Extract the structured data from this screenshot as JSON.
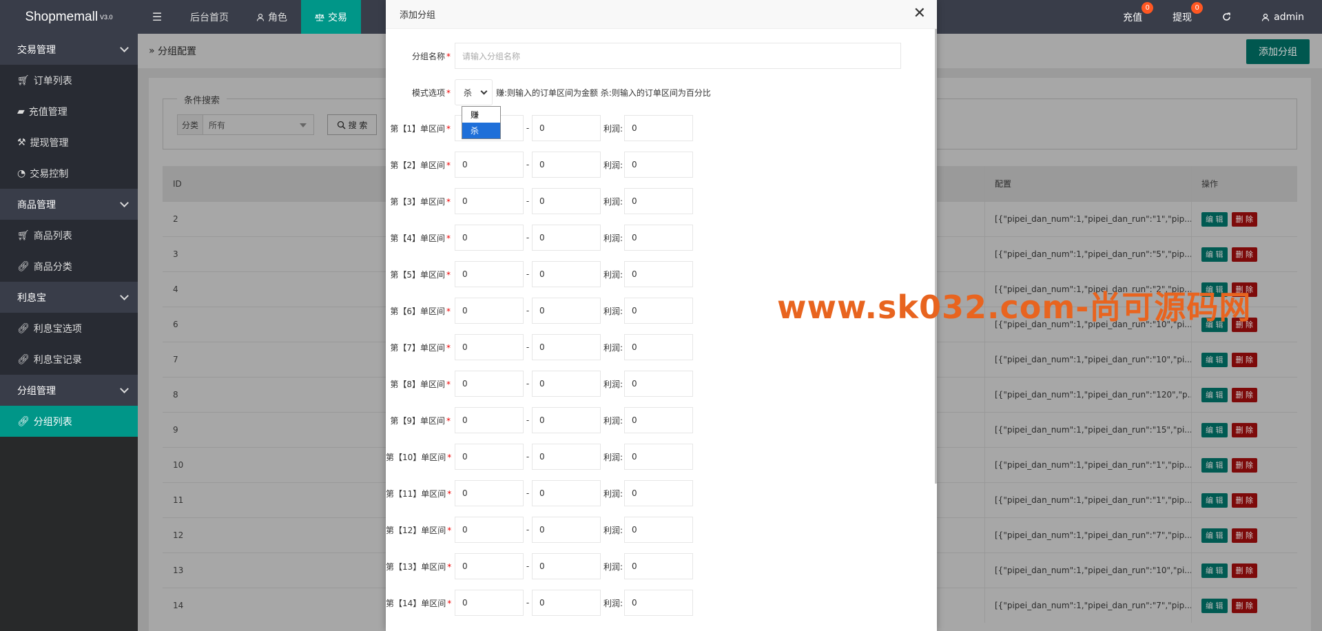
{
  "brand": {
    "name": "Shopmemall",
    "version": "V3.0"
  },
  "topnav": {
    "items": [
      {
        "label": "后台首页",
        "icon": ""
      },
      {
        "label": "角色",
        "icon": "user-icon"
      },
      {
        "label": "交易",
        "icon": "scale-icon",
        "active": true
      }
    ],
    "recharge": {
      "label": "充值",
      "badge": "0"
    },
    "withdraw": {
      "label": "提现",
      "badge": "0"
    },
    "admin": "admin"
  },
  "sidebar": {
    "groups": [
      {
        "label": "交易管理",
        "items": [
          {
            "label": "订单列表",
            "icon": "cart-icon"
          },
          {
            "label": "充值管理",
            "icon": "card-icon"
          },
          {
            "label": "提现管理",
            "icon": "hammer-icon"
          },
          {
            "label": "交易控制",
            "icon": "gauge-icon"
          }
        ]
      },
      {
        "label": "商品管理",
        "items": [
          {
            "label": "商品列表",
            "icon": "cart-icon"
          },
          {
            "label": "商品分类",
            "icon": "link-icon"
          }
        ]
      },
      {
        "label": "利息宝",
        "items": [
          {
            "label": "利息宝选项",
            "icon": "link-icon"
          },
          {
            "label": "利息宝记录",
            "icon": "link-icon"
          }
        ]
      },
      {
        "label": "分组管理",
        "items": [
          {
            "label": "分组列表",
            "icon": "link-icon",
            "active": true
          }
        ]
      }
    ]
  },
  "page": {
    "breadcrumb": "分组配置",
    "add_button": "添加分组",
    "filter": {
      "legend": "条件搜索",
      "category_label": "分类",
      "category_value": "所有",
      "search_button": "搜 索"
    },
    "table": {
      "headers": {
        "id": "ID",
        "config": "配置",
        "ops": "操作"
      },
      "edit_label": "编 辑",
      "delete_label": "删 除",
      "rows": [
        {
          "id": "2",
          "config": "[{\"pipei_dan_num\":1,\"pipei_dan_run\":\"1\",\"pip..."
        },
        {
          "id": "3",
          "config": "[{\"pipei_dan_num\":1,\"pipei_dan_run\":\"5\",\"pip..."
        },
        {
          "id": "4",
          "config": "[{\"pipei_dan_num\":1,\"pipei_dan_run\":\"2\",\"pip..."
        },
        {
          "id": "6",
          "config": "[{\"pipei_dan_num\":1,\"pipei_dan_run\":\"10\",\"pi..."
        },
        {
          "id": "7",
          "config": "[{\"pipei_dan_num\":1,\"pipei_dan_run\":\"10\",\"pi..."
        },
        {
          "id": "8",
          "config": "[{\"pipei_dan_num\":1,\"pipei_dan_run\":\"120\",\"p..."
        },
        {
          "id": "9",
          "config": "[{\"pipei_dan_num\":1,\"pipei_dan_run\":\"15\",\"pi..."
        },
        {
          "id": "10",
          "config": "[{\"pipei_dan_num\":1,\"pipei_dan_run\":\"1\",\"pip..."
        },
        {
          "id": "11",
          "config": "[{\"pipei_dan_num\":1,\"pipei_dan_run\":\"1\",\"pip..."
        },
        {
          "id": "12",
          "config": "[{\"pipei_dan_num\":1,\"pipei_dan_run\":\"7\",\"pip..."
        },
        {
          "id": "13",
          "config": "[{\"pipei_dan_num\":1,\"pipei_dan_run\":\"10\",\"pi..."
        },
        {
          "id": "14",
          "config": "[{\"pipei_dan_num\":1,\"pipei_dan_run\":\"7\",\"pip..."
        }
      ]
    }
  },
  "modal": {
    "title": "添加分组",
    "name_label": "分组名称",
    "name_placeholder": "请输入分组名称",
    "mode_label": "模式选项",
    "mode_value": "杀",
    "mode_hint": "赚:则输入的订单区间为金额 杀:则输入的订单区间为百分比",
    "mode_options": [
      "赚",
      "杀"
    ],
    "profit_label": "利润:",
    "intervals": [
      {
        "label": "第【1】单区间",
        "min": "0",
        "max": "0",
        "profit": "0"
      },
      {
        "label": "第【2】单区间",
        "min": "0",
        "max": "0",
        "profit": "0"
      },
      {
        "label": "第【3】单区间",
        "min": "0",
        "max": "0",
        "profit": "0"
      },
      {
        "label": "第【4】单区间",
        "min": "0",
        "max": "0",
        "profit": "0"
      },
      {
        "label": "第【5】单区间",
        "min": "0",
        "max": "0",
        "profit": "0"
      },
      {
        "label": "第【6】单区间",
        "min": "0",
        "max": "0",
        "profit": "0"
      },
      {
        "label": "第【7】单区间",
        "min": "0",
        "max": "0",
        "profit": "0"
      },
      {
        "label": "第【8】单区间",
        "min": "0",
        "max": "0",
        "profit": "0"
      },
      {
        "label": "第【9】单区间",
        "min": "0",
        "max": "0",
        "profit": "0"
      },
      {
        "label": "第【10】单区间",
        "min": "0",
        "max": "0",
        "profit": "0"
      },
      {
        "label": "第【11】单区间",
        "min": "0",
        "max": "0",
        "profit": "0"
      },
      {
        "label": "第【12】单区间",
        "min": "0",
        "max": "0",
        "profit": "0"
      },
      {
        "label": "第【13】单区间",
        "min": "0",
        "max": "0",
        "profit": "0"
      },
      {
        "label": "第【14】单区间",
        "min": "0",
        "max": "0",
        "profit": "0"
      }
    ]
  },
  "watermark": "www.sk032.com-尚可源码网",
  "colors": {
    "accent": "#009688",
    "danger": "#FF5722",
    "sidebar": "#393D49",
    "watermark": "#e8641f"
  }
}
